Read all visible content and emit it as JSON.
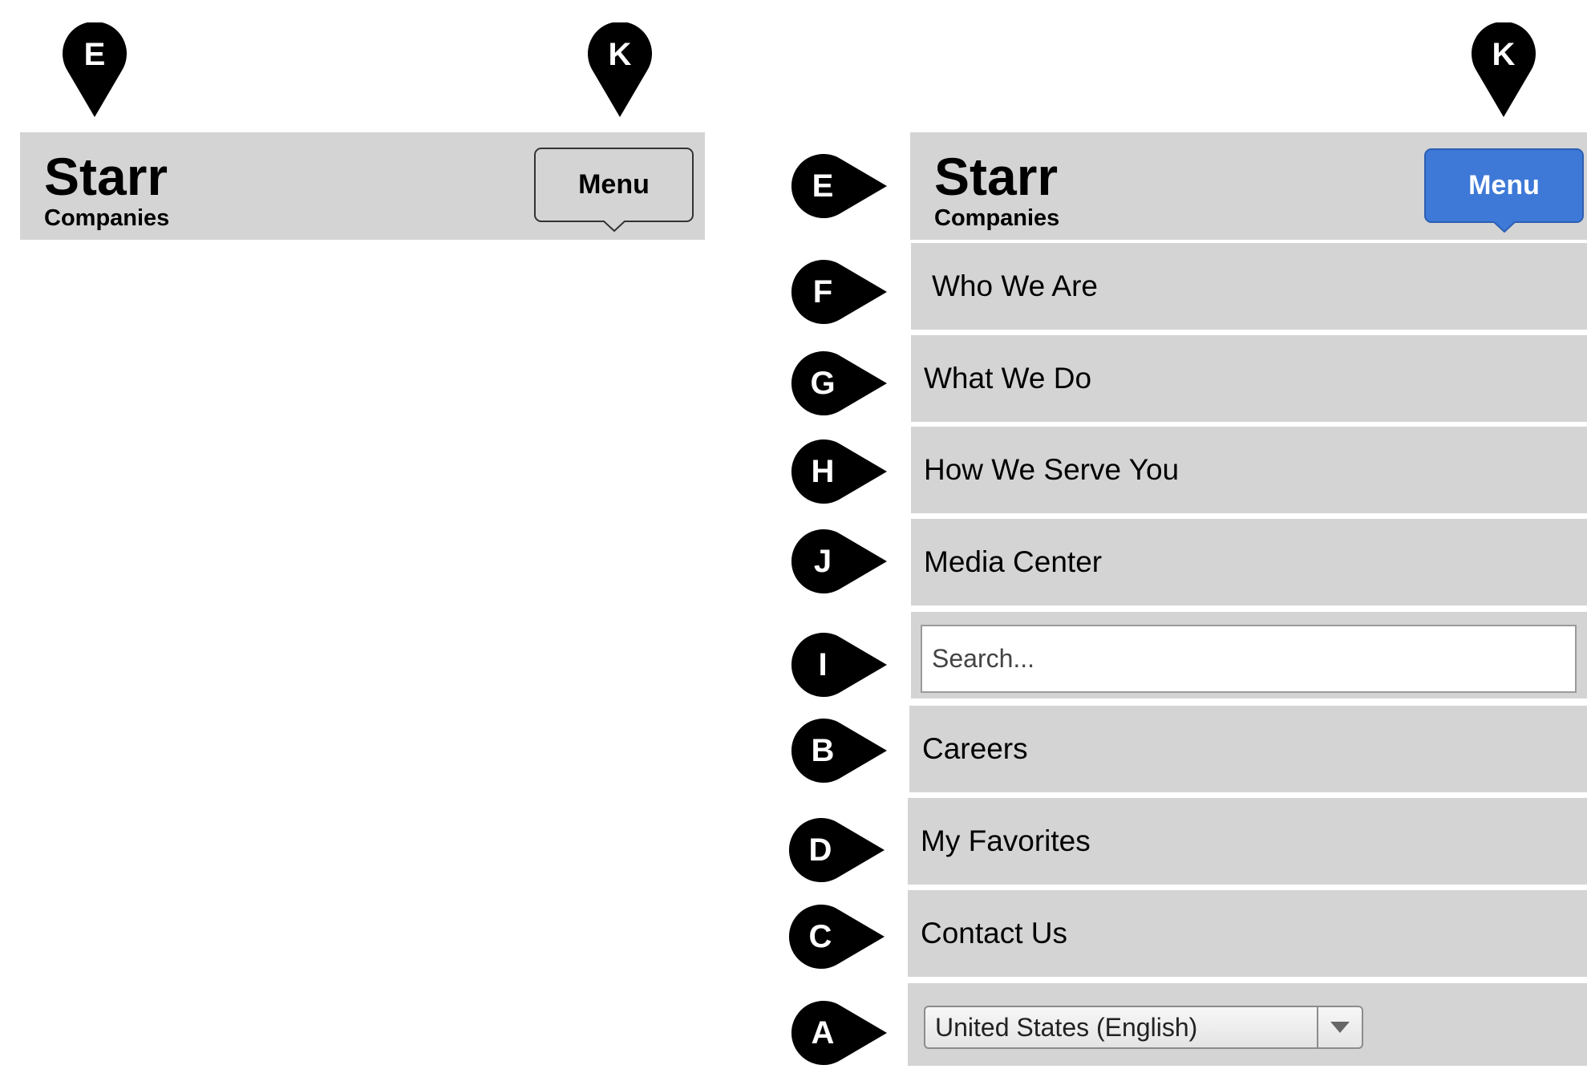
{
  "collapsed": {
    "brand": {
      "name": "Starr",
      "sub": "Companies"
    },
    "menu_label": "Menu",
    "markers": {
      "brand": "E",
      "menu": "K"
    }
  },
  "expanded": {
    "brand": {
      "name": "Starr",
      "sub": "Companies"
    },
    "menu_label": "Menu",
    "markers": {
      "brand": "E",
      "menu": "K"
    },
    "nav": [
      {
        "marker": "F",
        "label": "Who We Are"
      },
      {
        "marker": "G",
        "label": "What We Do"
      },
      {
        "marker": "H",
        "label": "How We Serve You"
      },
      {
        "marker": "J",
        "label": "Media Center"
      }
    ],
    "search": {
      "marker": "I",
      "placeholder": "Search..."
    },
    "links": [
      {
        "marker": "B",
        "label": "Careers"
      },
      {
        "marker": "D",
        "label": "My Favorites"
      },
      {
        "marker": "C",
        "label": "Contact Us"
      }
    ],
    "language": {
      "marker": "A",
      "selected": "United States (English)"
    }
  },
  "colors": {
    "bar": "#d4d4d4",
    "marker": "#000000",
    "menu_active": "#3e79d8",
    "menu_active_text": "#ffffff"
  }
}
